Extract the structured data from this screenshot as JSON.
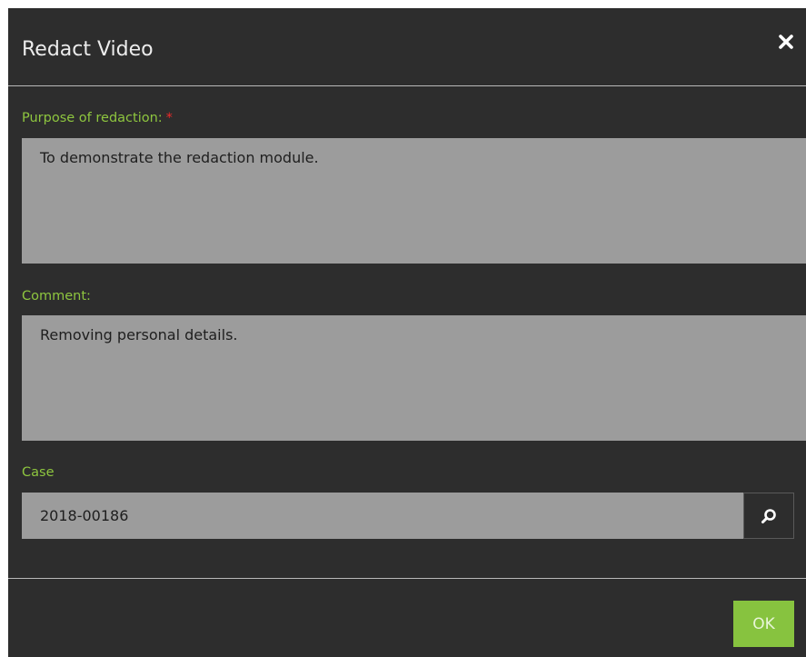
{
  "dialog": {
    "title": "Redact Video",
    "close_icon": "close-icon"
  },
  "purpose": {
    "label": "Purpose of redaction:",
    "required_marker": "*",
    "value": "To demonstrate the redaction module."
  },
  "comment": {
    "label": "Comment:",
    "value": "Removing personal details."
  },
  "case": {
    "label": "Case",
    "value": "2018-00186",
    "search_icon": "search-icon"
  },
  "footer": {
    "ok_label": "OK"
  },
  "colors": {
    "dialog_background": "#2d2d2d",
    "label_green": "#8ec63f",
    "required_red": "#ee2a2a",
    "field_background": "#9c9c9c",
    "ok_button": "#87c33f"
  }
}
